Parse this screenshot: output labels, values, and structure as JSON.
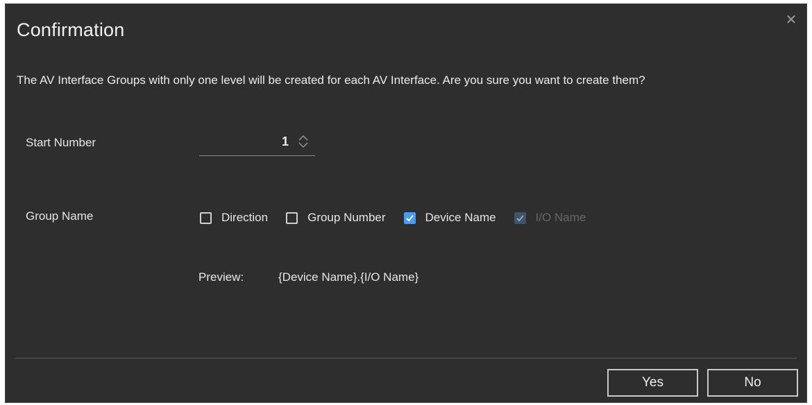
{
  "dialog": {
    "title": "Confirmation",
    "close_glyph": "✕",
    "message": "The AV Interface Groups with only one level will be created for each AV Interface. Are you sure you want to create them?"
  },
  "start_number": {
    "label": "Start Number",
    "value": "1"
  },
  "group_name": {
    "label": "Group Name",
    "options": [
      {
        "label": "Direction",
        "checked": false,
        "disabled": false
      },
      {
        "label": "Group Number",
        "checked": false,
        "disabled": false
      },
      {
        "label": "Device Name",
        "checked": true,
        "disabled": false
      },
      {
        "label": "I/O Name",
        "checked": true,
        "disabled": true
      }
    ]
  },
  "preview": {
    "label": "Preview:",
    "value": "{Device Name}.{I/O Name}"
  },
  "buttons": {
    "yes": "Yes",
    "no": "No"
  },
  "colors": {
    "background": "#2e2e2e",
    "accent": "#4f9ae6",
    "disabled_check": "#3f5469"
  },
  "icons": {
    "close": "close-icon",
    "stepper": "up-down-arrows-icon",
    "check": "checkmark-icon"
  }
}
